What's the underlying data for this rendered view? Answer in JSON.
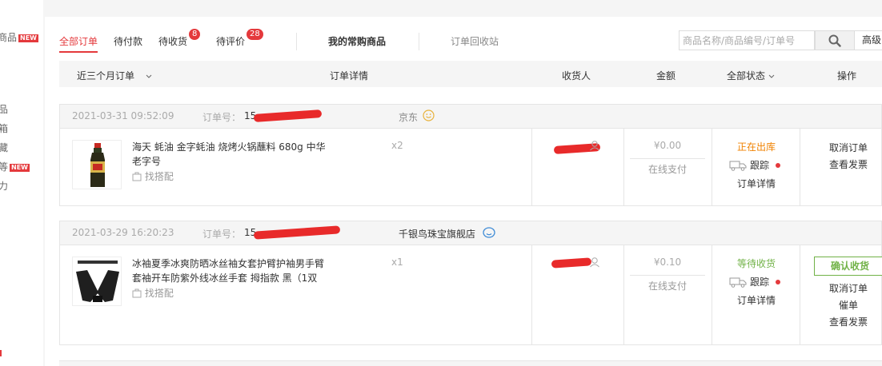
{
  "sidebar": {
    "items": [
      {
        "label": "商品",
        "badge": "NEW"
      },
      {
        "label": "品",
        "badge": ""
      },
      {
        "label": "箱",
        "badge": ""
      },
      {
        "label": "藏",
        "badge": ""
      },
      {
        "label": "等",
        "badge": "NEW"
      },
      {
        "label": "力",
        "badge": ""
      }
    ]
  },
  "tabs": {
    "all": "全部订单",
    "to_pay": "待付款",
    "to_receive": "待收货",
    "to_receive_count": "8",
    "to_review": "待评价",
    "to_review_count": "28",
    "frequent": "我的常购商品",
    "recycle": "订单回收站"
  },
  "search": {
    "placeholder": "商品名称/商品编号/订单号",
    "advanced_label": "高级"
  },
  "table_header": {
    "period": "近三个月订单",
    "details": "订单详情",
    "receiver": "收货人",
    "amount": "金额",
    "status": "全部状态",
    "actions": "操作"
  },
  "orders": [
    {
      "datetime": "2021-03-31 09:52:09",
      "order_no_label": "订单号：",
      "order_no": "15",
      "shop": "京东",
      "product_name": "海天 蚝油 金字蚝油 烧烤火锅蘸料 680g 中华老字号",
      "match_label": "找搭配",
      "qty": "x2",
      "amount": "¥0.00",
      "pay_method": "在线支付",
      "status": "正在出库",
      "status_color": "#f08200",
      "track_label": "跟踪",
      "detail_label": "订单详情",
      "actions": [
        "取消订单",
        "查看发票"
      ]
    },
    {
      "datetime": "2021-03-29 16:20:23",
      "order_no_label": "订单号：",
      "order_no": "15",
      "shop": "千银鸟珠宝旗舰店",
      "product_name": "冰袖夏季冰爽防晒冰丝袖女套护臂护袖男手臂套袖开车防紫外线冰丝手套 拇指款 黑（1双",
      "match_label": "找搭配",
      "qty": "x1",
      "amount": "¥0.10",
      "pay_method": "在线支付",
      "status": "等待收货",
      "status_color": "#71b247",
      "track_label": "跟踪",
      "detail_label": "订单详情",
      "confirm_label": "确认收货",
      "actions": [
        "取消订单",
        "催单",
        "查看发票"
      ]
    }
  ],
  "colors": {
    "accent": "#e4393c",
    "green": "#71b247",
    "orange": "#f08200"
  }
}
